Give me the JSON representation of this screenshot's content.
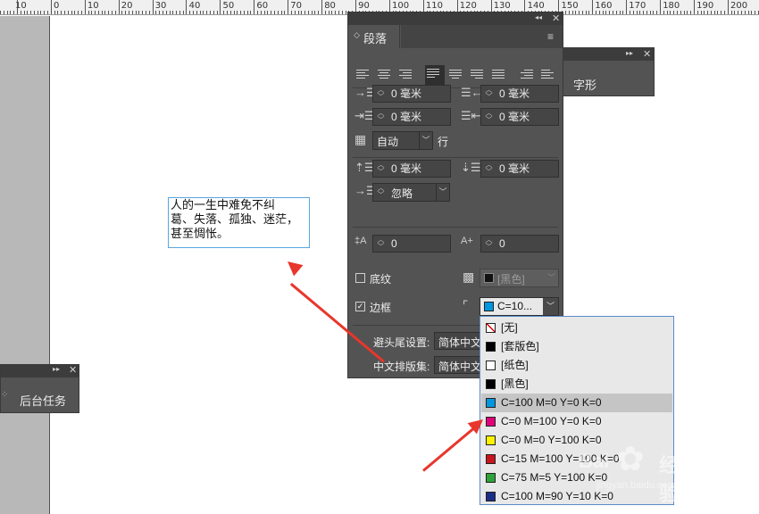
{
  "ruler": {
    "labels": [
      "10",
      "0",
      "10",
      "20",
      "30",
      "40",
      "50",
      "60",
      "70",
      "80",
      "90",
      "100",
      "110",
      "120",
      "130",
      "140",
      "150",
      "160",
      "170",
      "180",
      "190",
      "200"
    ]
  },
  "text_frame": {
    "lines": [
      "人的一生中难免不纠",
      "葛、失落、孤独、迷茫，",
      "甚至惆怅。"
    ]
  },
  "paragraph_panel": {
    "tab_label": "段落",
    "left_indent": "0 毫米",
    "right_indent": "0 毫米",
    "first_line_indent": "0 毫米",
    "last_line_indent": "0 毫米",
    "baseline_grid": "自动",
    "baseline_unit": "行",
    "space_before": "0 毫米",
    "space_after": "0 毫米",
    "drop_align": "忽略",
    "drop_cap_lines": "0",
    "drop_cap_chars": "0",
    "shading_label": "底纹",
    "shading_color": "[黑色]",
    "border_label": "边框",
    "border_color": "C=10...",
    "kinsoku_label": "避头尾设置:",
    "kinsoku_value": "简体中文",
    "mojikumi_label": "中文排版集:",
    "mojikumi_value": "简体中文"
  },
  "glyph_panel": {
    "title": "字形"
  },
  "background_tasks_panel": {
    "title": "后台任务"
  },
  "swatch_list": {
    "items": [
      {
        "label": "[无]",
        "color": "none"
      },
      {
        "label": "[套版色]",
        "color": "#000000"
      },
      {
        "label": "[纸色]",
        "color": "#ffffff"
      },
      {
        "label": "[黑色]",
        "color": "#000000"
      },
      {
        "label": "C=100 M=0 Y=0 K=0",
        "color": "#0096e0"
      },
      {
        "label": "C=0 M=100 Y=0 K=0",
        "color": "#e2007a"
      },
      {
        "label": "C=0 M=0 Y=100 K=0",
        "color": "#fff100"
      },
      {
        "label": "C=15 M=100 Y=100 K=0",
        "color": "#c8161e"
      },
      {
        "label": "C=75 M=5 Y=100 K=0",
        "color": "#2ea23a"
      },
      {
        "label": "C=100 M=90 Y=10 K=0",
        "color": "#1b2d86"
      }
    ],
    "selected_index": 4
  },
  "colors": {
    "panel_bg": "#535353",
    "selection_highlight": "#c5c5c5",
    "arrow_red": "#e8362c",
    "frame_blue": "#5aa6e0"
  },
  "watermark": {
    "brand": "Bai",
    "brand_cn": "经验",
    "url": "jingyan.baidu.com"
  }
}
